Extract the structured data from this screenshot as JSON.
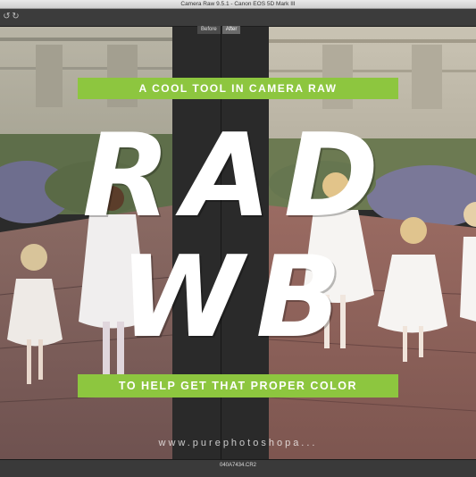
{
  "window": {
    "title": "Camera Raw 9.5.1  -  Canon EOS 5D Mark III"
  },
  "toolbar": {
    "icons": [
      "rotate-ccw-icon",
      "rotate-cw-icon"
    ],
    "rotate_ccw_glyph": "↺",
    "rotate_cw_glyph": "↻"
  },
  "view_tabs": {
    "before": "Before",
    "after": "After"
  },
  "overlay": {
    "top_banner": "A COOL TOOL IN CAMERA RAW",
    "line1": "RAD",
    "line2": "WB",
    "bottom_banner": "TO HELP GET THAT PROPER COLOR",
    "website": "www.purephotoshopa..."
  },
  "statusbar": {
    "filename": "040A7434.CR2"
  },
  "colors": {
    "accent_green": "#8dc63f",
    "panel_dark": "#2a2a2a"
  }
}
